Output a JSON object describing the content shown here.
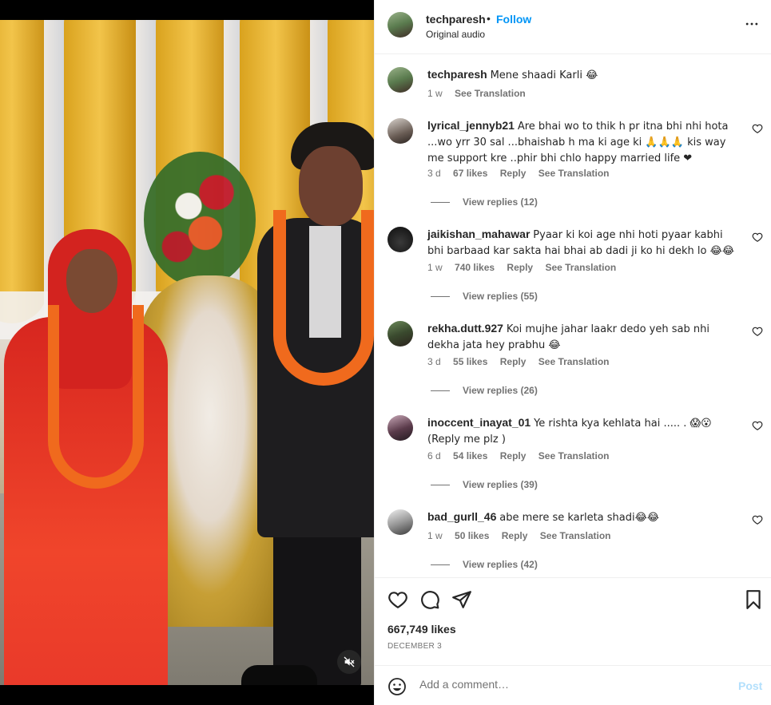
{
  "post": {
    "username": "techparesh",
    "dot": "•",
    "follow_label": "Follow",
    "audio": "Original audio",
    "caption_user": "techparesh",
    "caption_text": "Mene shaadi Karli 😂",
    "caption_time": "1 w",
    "caption_translate": "See Translation",
    "likes": "667,749 likes",
    "date": "DECEMBER 3"
  },
  "comments": [
    {
      "user": "lyrical_jennyb21",
      "text": "Are bhai wo to thik h pr itna bhi nhi hota ...wo yrr 30 sal ...bhaishab h ma ki age ki 🙏🙏🙏 kis way me support kre ..phir bhi chlo happy married life ❤",
      "time": "3 d",
      "likes": "67 likes",
      "reply": "Reply",
      "translate": "See Translation",
      "replies": "View replies (12)"
    },
    {
      "user": "jaikishan_mahawar",
      "text": "Pyaar ki koi age nhi hoti pyaar kabhi bhi barbaad kar sakta hai bhai ab dadi ji ko hi dekh lo 😂😂",
      "time": "1 w",
      "likes": "740 likes",
      "reply": "Reply",
      "translate": "See Translation",
      "replies": "View replies (55)"
    },
    {
      "user": "rekha.dutt.927",
      "text": "Koi mujhe jahar laakr dedo yeh sab nhi dekha jata hey prabhu 😂",
      "time": "3 d",
      "likes": "55 likes",
      "reply": "Reply",
      "translate": "See Translation",
      "replies": "View replies (26)"
    },
    {
      "user": "inoccent_inayat_01",
      "text": "Ye rishta kya kehlata hai ..... . 😱😮(Reply me plz )",
      "time": "6 d",
      "likes": "54 likes",
      "reply": "Reply",
      "translate": "See Translation",
      "replies": "View replies (39)"
    },
    {
      "user": "bad_gurll_46",
      "text": "abe mere se karleta shadi😂😂",
      "time": "1 w",
      "likes": "50 likes",
      "reply": "Reply",
      "translate": "See Translation",
      "replies": "View replies (42)"
    }
  ],
  "add_comment": {
    "placeholder": "Add a comment…",
    "post_label": "Post"
  },
  "colors": {
    "accent": "#0095f6",
    "post_disabled": "#b2dffc",
    "secondary_text": "#737373",
    "like_heart": "#ed4956"
  }
}
